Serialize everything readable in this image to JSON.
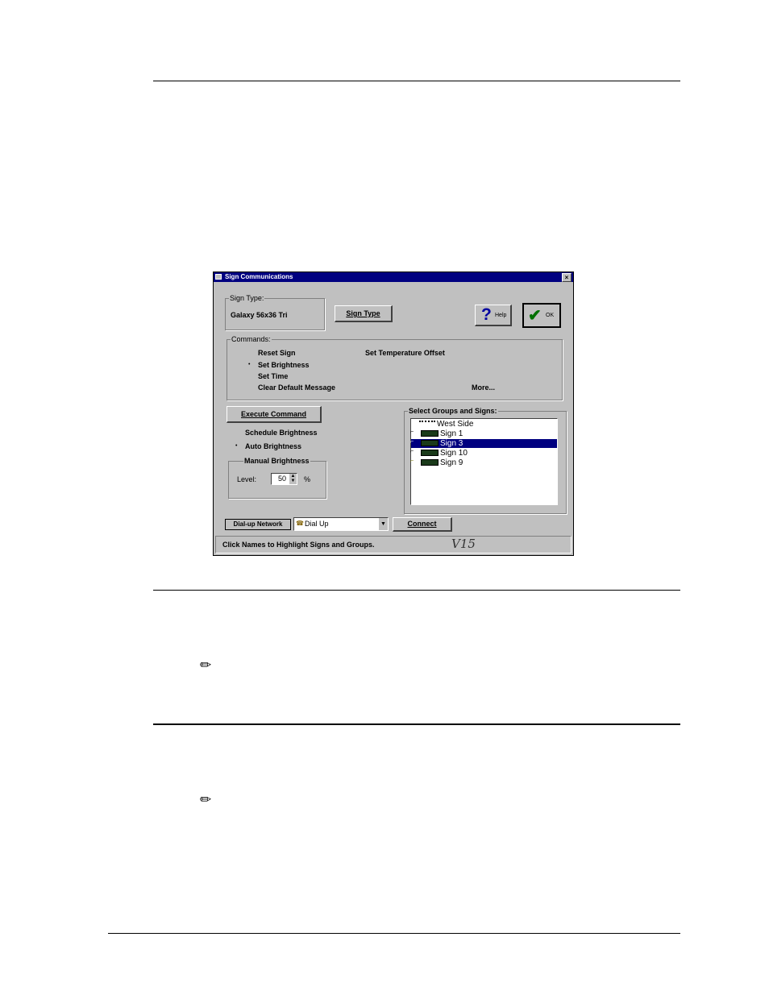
{
  "dialog": {
    "title": "Sign Communications",
    "close_glyph": "×",
    "sign_type": {
      "legend": "Sign Type:",
      "value": "Galaxy 56x36 Tri",
      "button": "Sign Type"
    },
    "help_button": "Help",
    "ok_button": "OK",
    "commands": {
      "legend": "Commands:",
      "items": [
        "Reset Sign",
        "Set Brightness",
        "Set Time",
        "Clear Default Message",
        "Set Temperature Offset"
      ],
      "selected": "Set Brightness",
      "more": "More..."
    },
    "execute_button": "Execute Command",
    "brightness": {
      "schedule": "Schedule Brightness",
      "auto": "Auto Brightness",
      "manual_legend": "Manual Brightness",
      "level_label": "Level:",
      "level_value": "50",
      "unit": "%"
    },
    "select_groups": {
      "legend": "Select Groups and Signs:",
      "items": [
        "West Side",
        "Sign 1",
        "Sign 3",
        "Sign 10",
        "Sign 9"
      ],
      "selected": "Sign 3"
    },
    "network": {
      "label": "Dial-up Network",
      "value": "Dial Up",
      "connect_button": "Connect"
    },
    "status_text": "Click Names to Highlight Signs and Groups.",
    "handwritten_note": "V15"
  },
  "icons": {
    "note1": "pencil-icon",
    "note2": "pencil-icon",
    "help": "question-icon",
    "ok": "checkmark-icon"
  }
}
